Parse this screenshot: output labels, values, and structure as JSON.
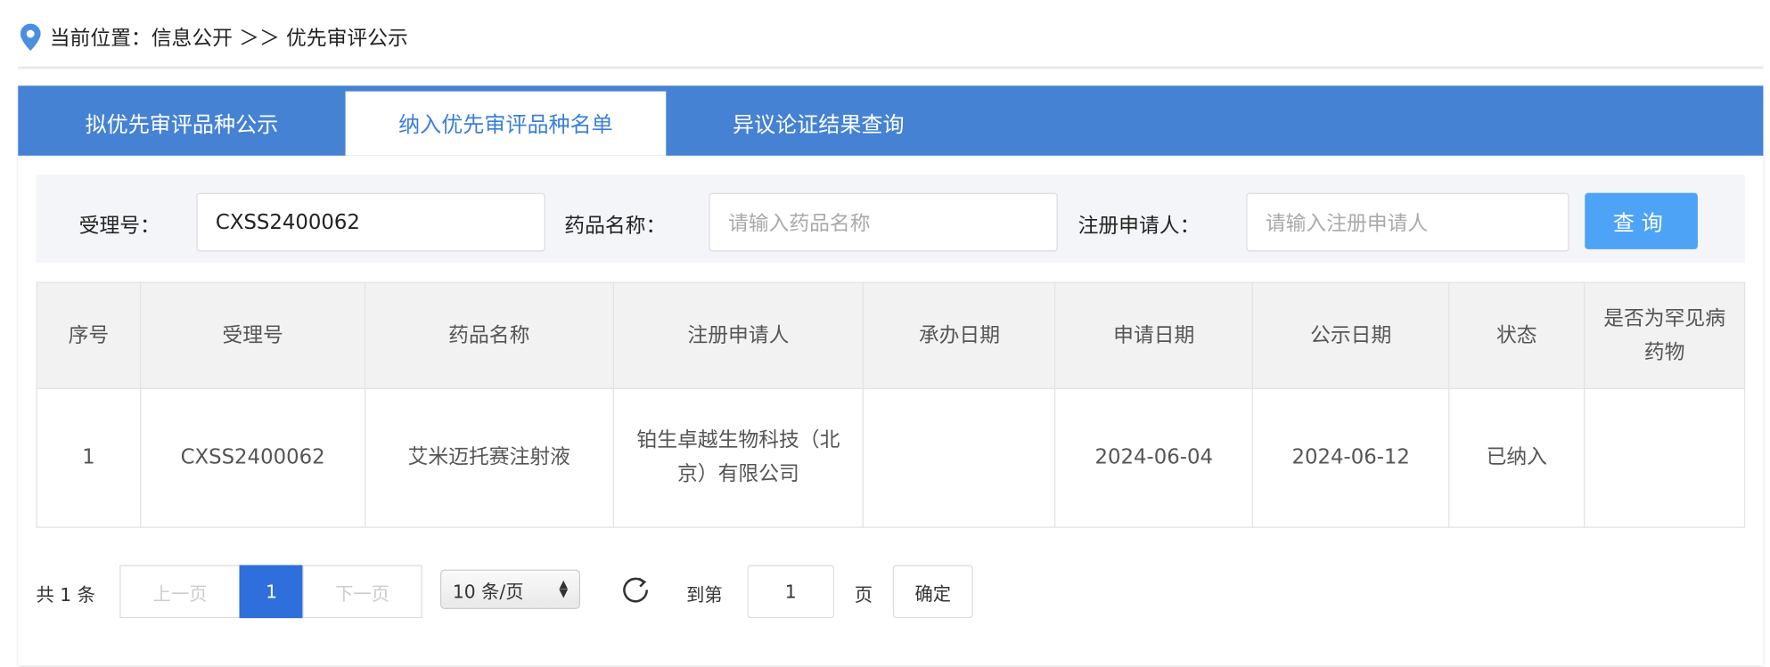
{
  "breadcrumb": {
    "text": "当前位置：信息公开 ＞＞ 优先审评公示"
  },
  "tabs": [
    {
      "label": "拟优先审评品种公示"
    },
    {
      "label": "纳入优先审评品种名单"
    },
    {
      "label": "异议论证结果查询"
    }
  ],
  "search": {
    "accept_label": "受理号：",
    "accept_value": "CXSS2400062",
    "drug_label": "药品名称：",
    "drug_placeholder": "请输入药品名称",
    "applicant_label": "注册申请人：",
    "applicant_placeholder": "请输入注册申请人",
    "query_button": "查询"
  },
  "table": {
    "headers": [
      "序号",
      "受理号",
      "药品名称",
      "注册申请人",
      "承办日期",
      "申请日期",
      "公示日期",
      "状态",
      "是否为罕见病药物"
    ],
    "rows": [
      [
        "1",
        "CXSS2400062",
        "艾米迈托赛注射液",
        "铂生卓越生物科技（北京）有限公司",
        "",
        "2024-06-04",
        "2024-06-12",
        "已纳入",
        ""
      ]
    ]
  },
  "pagination": {
    "total": "共 1 条",
    "prev": "上一页",
    "current": "1",
    "next": "下一页",
    "page_size": "10 条/页",
    "goto_label": "到第",
    "goto_value": "1",
    "page_suffix": "页",
    "confirm": "确定"
  }
}
